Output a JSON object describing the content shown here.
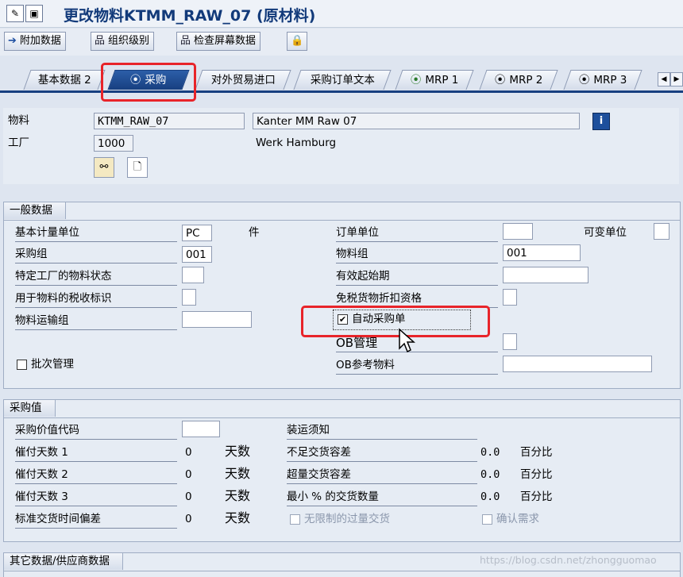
{
  "title": "更改物料KTMM_RAW_07 (原材料)",
  "toolbar": {
    "additional_data": "附加数据",
    "org_levels": "组织级别",
    "check_screen": "检查屏幕数据"
  },
  "tabs": [
    "基本数据 2",
    "采购",
    "对外贸易进口",
    "采购订单文本",
    "MRP 1",
    "MRP 2",
    "MRP 3"
  ],
  "header": {
    "material_label": "物料",
    "material_value": "KTMM_RAW_07",
    "material_desc": "Kanter MM Raw 07",
    "plant_label": "工厂",
    "plant_value": "1000",
    "plant_desc": "Werk Hamburg"
  },
  "general": {
    "title": "一般数据",
    "base_uom_label": "基本计量单位",
    "base_uom_value": "PC",
    "base_uom_text": "件",
    "order_unit_label": "订单单位",
    "variable_unit_label": "可变单位",
    "pur_group_label": "采购组",
    "pur_group_value": "001",
    "mat_group_label": "物料组",
    "mat_group_value": "001",
    "plant_status_label": "特定工厂的物料状态",
    "valid_from_label": "有效起始期",
    "tax_ind_label": "用于物料的税收标识",
    "tax_free_label": "免税货物折扣资格",
    "transport_group_label": "物料运输组",
    "auto_po_label": "自动采购单",
    "auto_po_checked": "✔",
    "ob_mgmt_label": "OB管理",
    "batch_label": "批次管理",
    "ob_ref_label": "OB参考物料"
  },
  "purchasing_values": {
    "title": "采购值",
    "value_key_label": "采购价值代码",
    "shipping_instr_label": "装运须知",
    "reminder1_label": "催付天数 1",
    "reminder1_value": "0",
    "reminder2_label": "催付天数 2",
    "reminder2_value": "0",
    "reminder3_label": "催付天数 3",
    "reminder3_value": "0",
    "std_dev_label": "标准交货时间偏差",
    "std_dev_value": "0",
    "days_unit": "天数",
    "under_tol_label": "不足交货容差",
    "under_tol_value": "0.0",
    "over_tol_label": "超量交货容差",
    "over_tol_value": "0.0",
    "min_del_label": "最小 % 的交货数量",
    "min_del_value": "0.0",
    "percent_unit": "百分比",
    "unlimited_label": "无限制的过量交货",
    "ack_req_label": "确认需求"
  },
  "other": {
    "title": "其它数据/供应商数据"
  },
  "watermark": "https://blog.csdn.net/zhongguomao",
  "colors": {
    "accent": "#173f80",
    "highlight_box": "#e8242a"
  }
}
